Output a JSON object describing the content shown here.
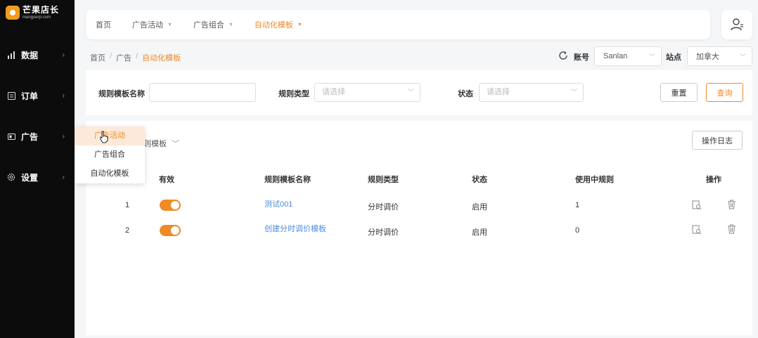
{
  "logo": {
    "title": "芒果店长",
    "subtitle": "mangoerp.com"
  },
  "sidebar": {
    "items": [
      {
        "label": "数据",
        "icon": "bar-chart-icon"
      },
      {
        "label": "订单",
        "icon": "order-icon"
      },
      {
        "label": "广告",
        "icon": "ad-icon"
      },
      {
        "label": "设置",
        "icon": "gear-icon"
      }
    ],
    "arrow": "›"
  },
  "flyout": {
    "items": [
      "广告活动",
      "广告组合",
      "自动化模板"
    ],
    "active_index": 0
  },
  "tabs": [
    {
      "label": "首页"
    },
    {
      "label": "广告活动"
    },
    {
      "label": "广告组合"
    },
    {
      "label": "自动化模板",
      "active": true
    }
  ],
  "breadcrumb": {
    "items": [
      "首页",
      "广告",
      "自动化模板"
    ],
    "separator": "/"
  },
  "account": {
    "label": "账号",
    "value": "Sanlan"
  },
  "site": {
    "label": "站点",
    "value": "加拿大"
  },
  "filters": {
    "name_label": "规则模板名称",
    "name_value": "",
    "type_label": "规则类型",
    "type_placeholder": "请选择",
    "status_label": "状态",
    "status_placeholder": "请选择",
    "reset_label": "重置",
    "query_label": "查询"
  },
  "main": {
    "template_select_partial": "则模板",
    "log_button": "操作日志"
  },
  "table": {
    "headers": {
      "enabled": "有效",
      "name": "规则模板名称",
      "type": "规则类型",
      "status": "状态",
      "in_use": "使用中规则",
      "actions": "操作"
    },
    "rows": [
      {
        "index": "1",
        "enabled": true,
        "name": "测试001",
        "type": "分时调价",
        "status": "启用",
        "in_use": "1"
      },
      {
        "index": "2",
        "enabled": true,
        "name": "创建分时调价模板",
        "type": "分时调价",
        "status": "启用",
        "in_use": "0"
      }
    ]
  },
  "colors": {
    "accent": "#f08a24",
    "link": "#4a8de0",
    "sidebar_bg": "#0c0c0c"
  }
}
